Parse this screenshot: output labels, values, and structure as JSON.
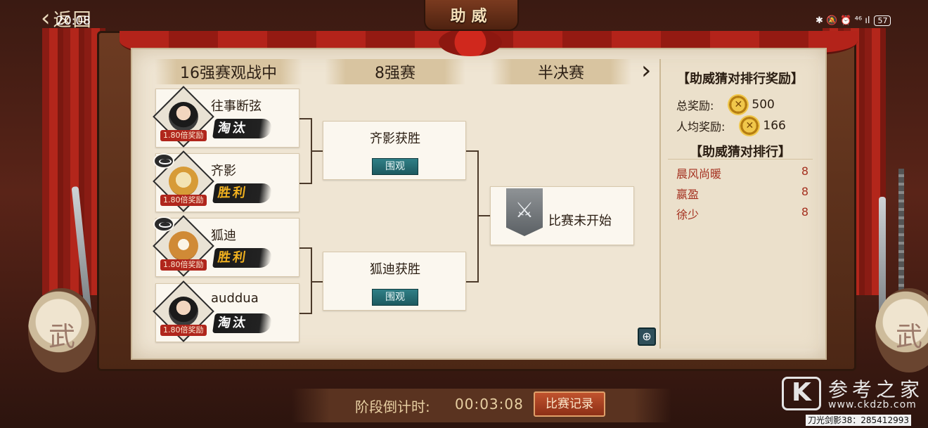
{
  "status_bar": {
    "time": "20:08",
    "icons": "✱ 🔕 ⏰ ⁴⁶ ıl",
    "battery": "57"
  },
  "nav": {
    "back_label": "返回",
    "back_icon": "chevron-left",
    "title": "助威"
  },
  "rounds": [
    {
      "label": "16强赛观战中"
    },
    {
      "label": "8强赛"
    },
    {
      "label": "半决赛"
    }
  ],
  "next_round_icon": "chevron-right",
  "players": [
    {
      "name": "往事断弦",
      "multiplier": "1.80倍奖励",
      "result": "淘汰"
    },
    {
      "name": "齐影",
      "multiplier": "1.80倍奖励",
      "result": "胜利"
    },
    {
      "name": "狐迪",
      "multiplier": "1.80倍奖励",
      "result": "胜利"
    },
    {
      "name": "auddua",
      "multiplier": "1.80倍奖励",
      "result": "淘汰"
    }
  ],
  "quarter_matches": [
    {
      "result": "齐影获胜",
      "button": "围观"
    },
    {
      "result": "狐迪获胜",
      "button": "围观"
    }
  ],
  "semifinal": {
    "status": "比赛未开始",
    "icon_glyph": "⚔"
  },
  "reward_panel": {
    "heading": "【助威猜对排行奖励】",
    "total_label": "总奖励:",
    "total_value": "500",
    "avg_label": "人均奖励:",
    "avg_value": "166",
    "coin_glyph": "✕"
  },
  "ranking": {
    "heading": "【助威猜对排行】",
    "rows": [
      {
        "name": "晨风尚暖",
        "score": "8"
      },
      {
        "name": "嬴盈",
        "score": "8"
      },
      {
        "name": "徐少",
        "score": "8"
      }
    ]
  },
  "footer": {
    "countdown_label": "阶段倒计时:",
    "countdown_value": "00:03:08",
    "record_button": "比赛记录"
  },
  "watermark": {
    "logo_letter": "K",
    "title": "参考之家",
    "url": "www.ckdzb.com",
    "caption": "刀光剑影38：285412993"
  },
  "drum_glyph": "武",
  "colors": {
    "accent_red": "#b0261c",
    "win_gold": "#f1b11f",
    "teal_button": "#2f7f86",
    "paper": "#efe5d3"
  }
}
